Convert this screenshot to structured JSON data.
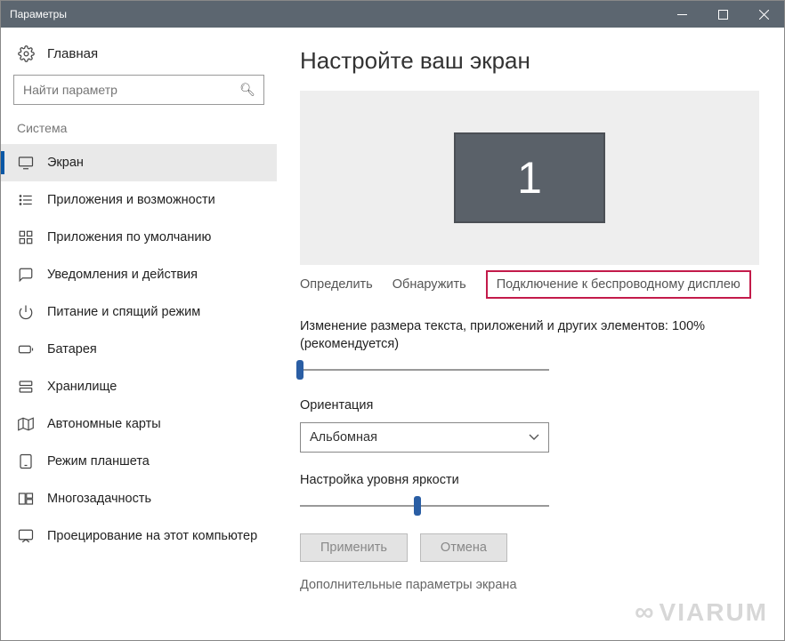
{
  "titlebar": {
    "title": "Параметры"
  },
  "sidebar": {
    "home_label": "Главная",
    "search_placeholder": "Найти параметр",
    "group_label": "Система",
    "items": [
      {
        "label": "Экран",
        "icon": "monitor-icon",
        "active": true
      },
      {
        "label": "Приложения и возможности",
        "icon": "list-icon"
      },
      {
        "label": "Приложения по умолчанию",
        "icon": "grid-icon"
      },
      {
        "label": "Уведомления и действия",
        "icon": "message-icon"
      },
      {
        "label": "Питание и спящий режим",
        "icon": "power-icon"
      },
      {
        "label": "Батарея",
        "icon": "battery-icon"
      },
      {
        "label": "Хранилище",
        "icon": "storage-icon"
      },
      {
        "label": "Автономные карты",
        "icon": "map-icon"
      },
      {
        "label": "Режим планшета",
        "icon": "tablet-icon"
      },
      {
        "label": "Многозадачность",
        "icon": "multitask-icon"
      },
      {
        "label": "Проецирование на этот компьютер",
        "icon": "project-icon"
      }
    ]
  },
  "main": {
    "heading": "Настройте ваш экран",
    "monitor_number": "1",
    "links": {
      "detect": "Определить",
      "identify": "Обнаружить",
      "wireless": "Подключение к беспроводному дисплею"
    },
    "scale_label": "Изменение размера текста, приложений и других элементов: 100% (рекомендуется)",
    "scale_value": 0,
    "orientation_label": "Ориентация",
    "orientation_value": "Альбомная",
    "brightness_label": "Настройка уровня яркости",
    "brightness_value": 47,
    "apply_label": "Применить",
    "cancel_label": "Отмена",
    "advanced_label": "Дополнительные параметры экрана"
  },
  "watermark": "VIARUM"
}
